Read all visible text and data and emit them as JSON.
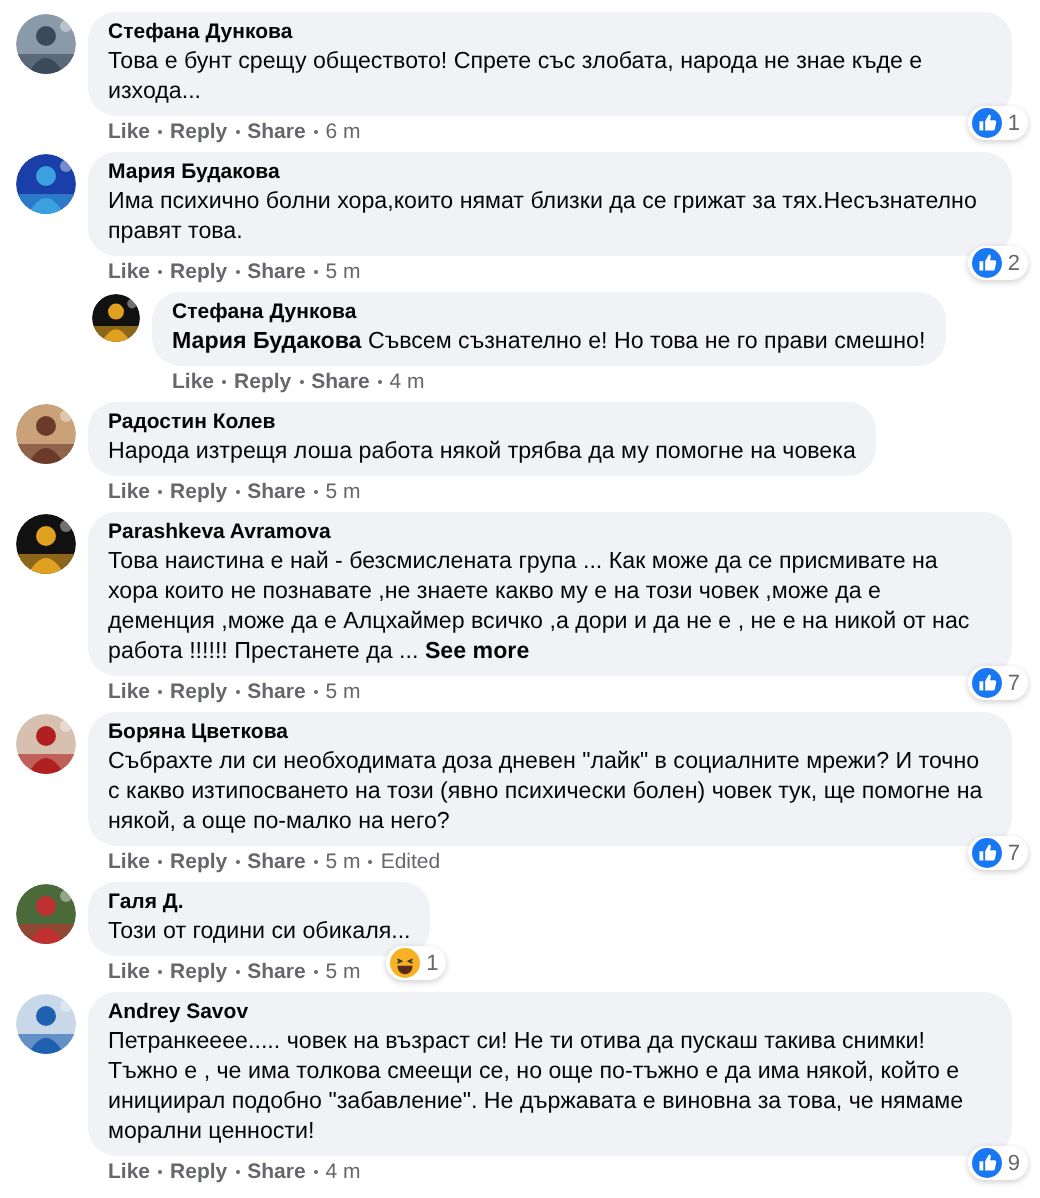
{
  "comments": [
    {
      "author": "Стефана Дункова",
      "text": "Това е бунт срещу обществото! Спрете със злобата, народа не знае къде е изхода...",
      "actions": [
        "Like",
        "Reply",
        "Share"
      ],
      "time": "6 m",
      "reaction": {
        "kind": "like",
        "count": "1"
      }
    },
    {
      "author": "Мария Будакова",
      "text": "Има психично болни хора,които нямат близки да се грижат за тях.Несъзнателно правят това.",
      "actions": [
        "Like",
        "Reply",
        "Share"
      ],
      "time": "5 m",
      "reaction": {
        "kind": "like",
        "count": "2"
      },
      "children": [
        {
          "author": "Стефана Дункова",
          "text": "**Мария Будакова** Съвсем съзнателно е! Но това не го прави смешно!",
          "actions": [
            "Like",
            "Reply",
            "Share"
          ],
          "time": "4 m"
        }
      ]
    },
    {
      "author": "Радостин Колев",
      "text": "Народа изтрещя лоша работа някой трябва да му помогне на човека",
      "actions": [
        "Like",
        "Reply",
        "Share"
      ],
      "time": "5 m"
    },
    {
      "author": "Parashkeva Avramova",
      "text": "Това наистина е най - безсмислената група ... Как може да се присмивате на хора които не познавате ,не знаете какво му е на този човек ,може да е деменция ,може да е Алцхаймер всичко ,а дори и да не е , не е на никой от нас работа !!!!!! Престанете да ...",
      "see_more": "See more",
      "actions": [
        "Like",
        "Reply",
        "Share"
      ],
      "time": "5 m",
      "reaction": {
        "kind": "like",
        "count": "7"
      }
    },
    {
      "author": "Боряна Цветкова",
      "text": "Събрахте ли си необходимата доза дневен \"лайк\" в социалните мрежи? И точно с какво изтипосването на този (явно психически болен) човек тук, ще помогне на някой, а още по-малко на него?",
      "actions": [
        "Like",
        "Reply",
        "Share"
      ],
      "time": "5 m",
      "edited": "Edited",
      "reaction": {
        "kind": "like",
        "count": "7"
      }
    },
    {
      "author": "Галя Д.",
      "text": "Този от години си обикаля...",
      "actions": [
        "Like",
        "Reply",
        "Share"
      ],
      "time": "5 m",
      "reaction": {
        "kind": "haha",
        "count": "1"
      }
    },
    {
      "author": "Andrey Savov",
      "text": "Петранкееее..... човек на възраст си! Не ти отива да пускаш такива снимки! Тъжно е , че има толкова смеещи се, но още по-тъжно е да има някой, който е инициирал подобно \"забавление\". Не държавата е виновна за това, че нямаме морални ценности!",
      "actions": [
        "Like",
        "Reply",
        "Share"
      ],
      "time": "4 m",
      "reaction": {
        "kind": "like",
        "count": "9"
      }
    }
  ]
}
